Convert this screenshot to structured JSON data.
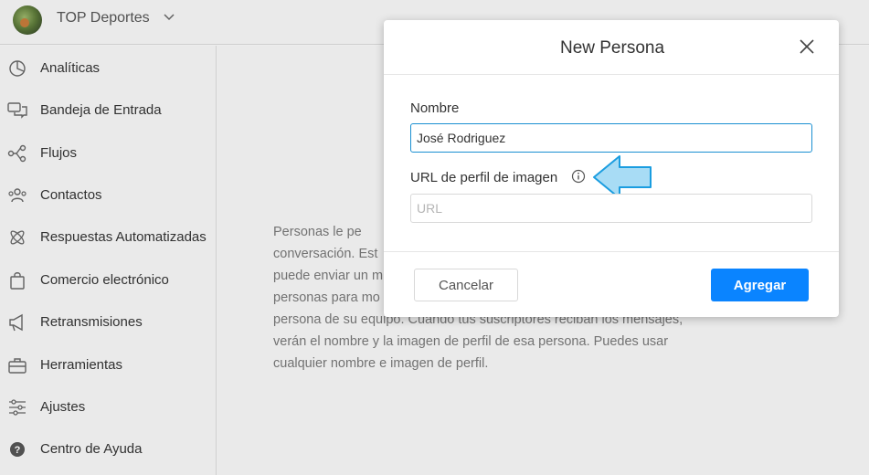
{
  "header": {
    "brand": "TOP Deportes"
  },
  "sidebar": {
    "items": [
      {
        "label": "Analíticas",
        "icon": "pie-chart-icon"
      },
      {
        "label": "Bandeja de Entrada",
        "icon": "chat-bubbles-icon"
      },
      {
        "label": "Flujos",
        "icon": "flow-icon"
      },
      {
        "label": "Contactos",
        "icon": "contacts-icon"
      },
      {
        "label": "Respuestas Automatizadas",
        "icon": "atom-icon"
      },
      {
        "label": "Comercio electrónico",
        "icon": "shopping-bag-icon"
      },
      {
        "label": "Retransmisiones",
        "icon": "megaphone-icon"
      },
      {
        "label": "Herramientas",
        "icon": "toolbox-icon"
      },
      {
        "label": "Ajustes",
        "icon": "sliders-icon"
      },
      {
        "label": "Centro de Ayuda",
        "icon": "help-icon"
      }
    ]
  },
  "main": {
    "description_lines": [
      "Personas le pe",
      "conversación. Est",
      "puede enviar un m",
      "personas para mo",
      "persona de su equipo. Cuando tus suscriptores reciban los mensajes,",
      "verán el nombre y la imagen de perfil de esa persona. Puedes usar",
      "cualquier nombre e imagen de perfil."
    ]
  },
  "modal": {
    "title": "New Persona",
    "name_label": "Nombre",
    "name_value": "José Rodriguez",
    "url_label": "URL de perfil de imagen",
    "url_placeholder": "URL",
    "cancel_label": "Cancelar",
    "add_label": "Agregar"
  },
  "colors": {
    "primary": "#0a84ff",
    "active_border": "#1a8fd1",
    "arrow_fill": "#a8dcf5",
    "arrow_stroke": "#1a9de0"
  }
}
